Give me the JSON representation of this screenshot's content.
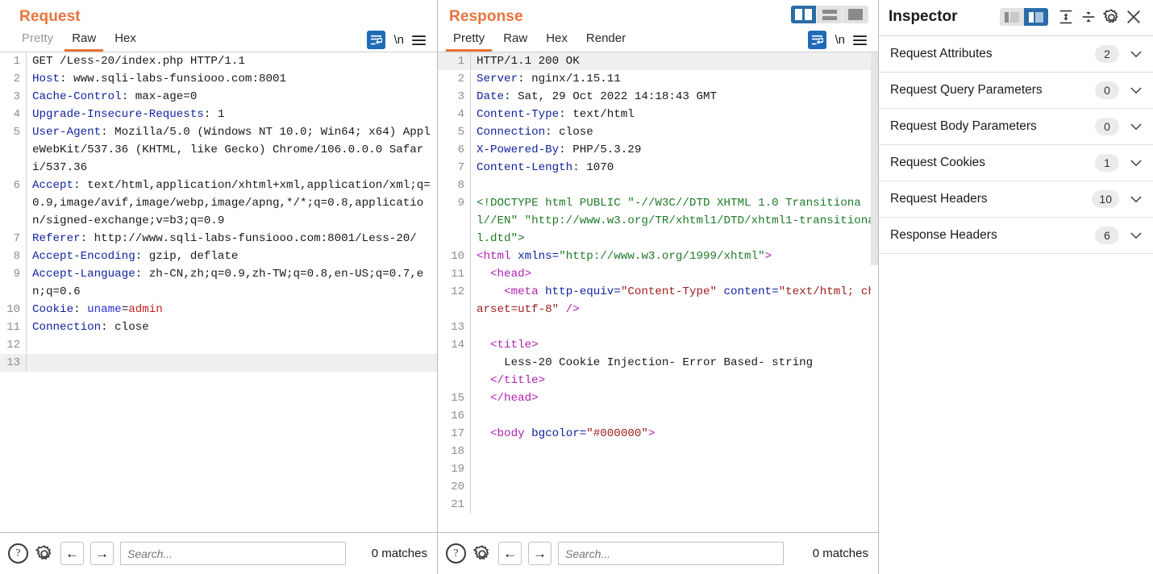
{
  "request": {
    "title": "Request",
    "tabs": [
      {
        "label": "Pretty",
        "active": false,
        "muted": true
      },
      {
        "label": "Raw",
        "active": true,
        "muted": false
      },
      {
        "label": "Hex",
        "active": false,
        "muted": false
      }
    ],
    "tools": {
      "wrap_icon": "word-wrap-icon",
      "newline_label": "\\n",
      "menu_icon": "hamburger-menu-icon"
    },
    "lines": [
      {
        "n": "1",
        "segs": [
          {
            "t": "GET /Less-20/index.php HTTP/1.1",
            "c": "val"
          }
        ]
      },
      {
        "n": "2",
        "segs": [
          {
            "t": "Host",
            "c": "hdr"
          },
          {
            "t": ": www.sqli-labs-funsiooo.com:8001",
            "c": "val"
          }
        ]
      },
      {
        "n": "3",
        "segs": [
          {
            "t": "Cache-Control",
            "c": "hdr"
          },
          {
            "t": ": max-age=0",
            "c": "val"
          }
        ]
      },
      {
        "n": "4",
        "segs": [
          {
            "t": "Upgrade-Insecure-Requests",
            "c": "hdr"
          },
          {
            "t": ": 1",
            "c": "val"
          }
        ]
      },
      {
        "n": "5",
        "segs": [
          {
            "t": "User-Agent",
            "c": "hdr"
          },
          {
            "t": ": Mozilla/5.0 (Windows NT 10.0; Win64; x64) AppleWebKit/537.36 (KHTML, like Gecko) Chrome/106.0.0.0 Safari/537.36",
            "c": "val"
          }
        ]
      },
      {
        "n": "6",
        "segs": [
          {
            "t": "Accept",
            "c": "hdr"
          },
          {
            "t": ": text/html,application/xhtml+xml,application/xml;q=0.9,image/avif,image/webp,image/apng,*/*;q=0.8,application/signed-exchange;v=b3;q=0.9",
            "c": "val"
          }
        ]
      },
      {
        "n": "7",
        "segs": [
          {
            "t": "Referer",
            "c": "hdr"
          },
          {
            "t": ": http://www.sqli-labs-funsiooo.com:8001/Less-20/",
            "c": "val"
          }
        ]
      },
      {
        "n": "8",
        "segs": [
          {
            "t": "Accept-Encoding",
            "c": "hdr"
          },
          {
            "t": ": gzip, deflate",
            "c": "val"
          }
        ]
      },
      {
        "n": "9",
        "segs": [
          {
            "t": "Accept-Language",
            "c": "hdr"
          },
          {
            "t": ": zh-CN,zh;q=0.9,zh-TW;q=0.8,en-US;q=0.7,en;q=0.6",
            "c": "val"
          }
        ]
      },
      {
        "n": "10",
        "segs": [
          {
            "t": "Cookie",
            "c": "hdr"
          },
          {
            "t": ": ",
            "c": "val"
          },
          {
            "t": "uname",
            "c": "ck"
          },
          {
            "t": "=",
            "c": "val"
          },
          {
            "t": "admin",
            "c": "ckv"
          }
        ]
      },
      {
        "n": "11",
        "segs": [
          {
            "t": "Connection",
            "c": "hdr"
          },
          {
            "t": ": close",
            "c": "val"
          }
        ]
      },
      {
        "n": "12",
        "segs": [
          {
            "t": "",
            "c": "val"
          }
        ]
      },
      {
        "n": "13",
        "segs": [
          {
            "t": "",
            "c": "val"
          }
        ],
        "hl": true
      }
    ],
    "footer": {
      "help_icon": "help-icon",
      "settings_icon": "gear-icon",
      "prev_icon": "arrow-left-icon",
      "next_icon": "arrow-right-icon",
      "search_placeholder": "Search...",
      "search_value": "",
      "matches": "0 matches"
    }
  },
  "response": {
    "title": "Response",
    "tabs": [
      {
        "label": "Pretty",
        "active": true,
        "muted": false
      },
      {
        "label": "Raw",
        "active": false,
        "muted": false
      },
      {
        "label": "Hex",
        "active": false,
        "muted": false
      },
      {
        "label": "Render",
        "active": false,
        "muted": false
      }
    ],
    "layout_buttons": [
      {
        "name": "layout-vertical-split",
        "active": true
      },
      {
        "name": "layout-horizontal-split",
        "active": false
      },
      {
        "name": "layout-single-pane",
        "active": false
      }
    ],
    "tools": {
      "wrap_icon": "word-wrap-icon",
      "newline_label": "\\n",
      "menu_icon": "hamburger-menu-icon"
    },
    "lines": [
      {
        "n": "1",
        "hl": true,
        "segs": [
          {
            "t": "HTTP/1.1 200 OK",
            "c": "val"
          }
        ]
      },
      {
        "n": "2",
        "segs": [
          {
            "t": "Server",
            "c": "hdr"
          },
          {
            "t": ": nginx/1.15.11",
            "c": "val"
          }
        ]
      },
      {
        "n": "3",
        "segs": [
          {
            "t": "Date",
            "c": "hdr"
          },
          {
            "t": ": Sat, 29 Oct 2022 14:18:43 GMT",
            "c": "val"
          }
        ]
      },
      {
        "n": "4",
        "segs": [
          {
            "t": "Content-Type",
            "c": "hdr"
          },
          {
            "t": ": text/html",
            "c": "val"
          }
        ]
      },
      {
        "n": "5",
        "segs": [
          {
            "t": "Connection",
            "c": "hdr"
          },
          {
            "t": ": close",
            "c": "val"
          }
        ]
      },
      {
        "n": "6",
        "segs": [
          {
            "t": "X-Powered-By",
            "c": "hdr"
          },
          {
            "t": ": PHP/5.3.29",
            "c": "val"
          }
        ]
      },
      {
        "n": "7",
        "segs": [
          {
            "t": "Content-Length",
            "c": "hdr"
          },
          {
            "t": ": 1070",
            "c": "val"
          }
        ]
      },
      {
        "n": "8",
        "segs": [
          {
            "t": "",
            "c": "val"
          }
        ]
      },
      {
        "n": "9",
        "segs": [
          {
            "t": "<!DOCTYPE html PUBLIC \"-//W3C//DTD XHTML 1.0 Transitional//EN\" \"http://www.w3.org/TR/xhtml1/DTD/xhtml1-transitional.dtd\">",
            "c": "dt"
          }
        ]
      },
      {
        "n": "10",
        "segs": [
          {
            "t": "<html ",
            "c": "tg"
          },
          {
            "t": "xmlns=",
            "c": "at"
          },
          {
            "t": "\"http://www.w3.org/1999/xhtml\"",
            "c": "dt"
          },
          {
            "t": ">",
            "c": "tg"
          }
        ]
      },
      {
        "n": "11",
        "segs": [
          {
            "t": "  <head>",
            "c": "tg"
          }
        ]
      },
      {
        "n": "12",
        "segs": [
          {
            "t": "    <meta ",
            "c": "tg"
          },
          {
            "t": "http-equiv=",
            "c": "at"
          },
          {
            "t": "\"Content-Type\"",
            "c": "av"
          },
          {
            "t": " ",
            "c": "pl"
          },
          {
            "t": "content=",
            "c": "at"
          },
          {
            "t": "\"text/html; charset=utf-8\"",
            "c": "av"
          },
          {
            "t": " />",
            "c": "tg"
          }
        ]
      },
      {
        "n": "13",
        "segs": [
          {
            "t": "",
            "c": "val"
          }
        ]
      },
      {
        "n": "14",
        "segs": [
          {
            "t": "  <title>",
            "c": "tg"
          },
          {
            "t": "\n    Less-20 Cookie Injection- Error Based- string\n  ",
            "c": "pl"
          },
          {
            "t": "</title>",
            "c": "tg"
          }
        ]
      },
      {
        "n": "15",
        "segs": [
          {
            "t": "  </head>",
            "c": "tg"
          }
        ]
      },
      {
        "n": "16",
        "segs": [
          {
            "t": "",
            "c": "val"
          }
        ]
      },
      {
        "n": "17",
        "segs": [
          {
            "t": "  <body ",
            "c": "tg"
          },
          {
            "t": "bgcolor=",
            "c": "at"
          },
          {
            "t": "\"#000000\"",
            "c": "av"
          },
          {
            "t": ">",
            "c": "tg"
          }
        ]
      },
      {
        "n": "18",
        "segs": [
          {
            "t": "",
            "c": "val"
          }
        ]
      },
      {
        "n": "19",
        "segs": [
          {
            "t": "",
            "c": "val"
          }
        ]
      },
      {
        "n": "20",
        "segs": [
          {
            "t": "",
            "c": "val"
          }
        ]
      },
      {
        "n": "21",
        "segs": [
          {
            "t": "",
            "c": "val"
          }
        ]
      }
    ],
    "footer": {
      "help_icon": "help-icon",
      "settings_icon": "gear-icon",
      "prev_icon": "arrow-left-icon",
      "next_icon": "arrow-right-icon",
      "search_placeholder": "Search...",
      "search_value": "",
      "matches": "0 matches"
    }
  },
  "inspector": {
    "title": "Inspector",
    "header_icons": [
      {
        "name": "panel-left-toggle",
        "active": false
      },
      {
        "name": "panel-right-toggle",
        "active": true
      },
      {
        "name": "expand-all-icon",
        "active": false
      },
      {
        "name": "collapse-all-icon",
        "active": false
      },
      {
        "name": "gear-icon",
        "active": false
      },
      {
        "name": "close-icon",
        "active": false
      }
    ],
    "sections": [
      {
        "label": "Request Attributes",
        "count": "2"
      },
      {
        "label": "Request Query Parameters",
        "count": "0"
      },
      {
        "label": "Request Body Parameters",
        "count": "0"
      },
      {
        "label": "Request Cookies",
        "count": "1"
      },
      {
        "label": "Request Headers",
        "count": "10"
      },
      {
        "label": "Response Headers",
        "count": "6"
      }
    ]
  },
  "colors": {
    "accent_orange": "#e8743b",
    "accent_blue": "#2a6ca8",
    "header_blue": "#12239e",
    "tag_purple": "#b020b0",
    "attr_value_red": "#9c1c1c",
    "doctype_green": "#1f7a28",
    "cookie_value_red": "#c0231f"
  }
}
